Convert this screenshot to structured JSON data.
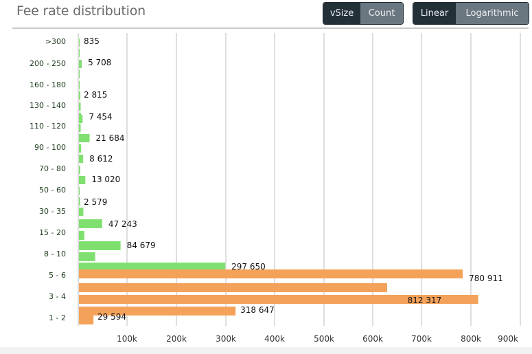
{
  "header": {
    "title": "Fee rate distribution",
    "metric_toggle": {
      "options": [
        "vSize",
        "Count"
      ],
      "selected": "vSize"
    },
    "scale_toggle": {
      "options": [
        "Linear",
        "Logarithmic"
      ],
      "selected": "Linear"
    }
  },
  "colors": {
    "low_fee_bar": "#7fe070",
    "high_volume_bar": "#f4a15a",
    "grid": "#d4d4d4",
    "button_active": "#233038",
    "button_inactive": "#6b7780"
  },
  "chart_data": {
    "type": "bar",
    "orientation": "horizontal",
    "title": "Fee rate distribution",
    "xlabel": "",
    "ylabel": "",
    "xlim": [
      0,
      900000
    ],
    "x_ticks": [
      "100k",
      "200k",
      "300k",
      "400k",
      "500k",
      "600k",
      "700k",
      "800k",
      "900k"
    ],
    "x_tick_values": [
      100000,
      200000,
      300000,
      400000,
      500000,
      600000,
      700000,
      800000,
      900000
    ],
    "grid": true,
    "legend": "none",
    "category_labels": [
      ">300",
      "200 - 250",
      "160 - 180",
      "130 - 140",
      "110 - 120",
      "90 - 100",
      "70 - 80",
      "50 - 60",
      "30 - 35",
      "15 - 20",
      "8 - 10",
      "5 - 6",
      "3 - 4",
      "1 - 2"
    ],
    "bars": [
      {
        "value": 835,
        "label": "835",
        "color": "green"
      },
      {
        "value": 1500,
        "label": "",
        "color": "green"
      },
      {
        "value": 5708,
        "label": "5 708",
        "color": "green"
      },
      {
        "value": 1000,
        "label": "",
        "color": "green"
      },
      {
        "value": 900,
        "label": "",
        "color": "green"
      },
      {
        "value": 2815,
        "label": "2 815",
        "color": "green"
      },
      {
        "value": 3500,
        "label": "",
        "color": "green"
      },
      {
        "value": 4500,
        "label": "",
        "color": "green"
      },
      {
        "value": 7454,
        "label": "7 454",
        "color": "green"
      },
      {
        "value": 3500,
        "label": "",
        "color": "green"
      },
      {
        "value": 21684,
        "label": "21 684",
        "color": "green"
      },
      {
        "value": 4500,
        "label": "",
        "color": "green"
      },
      {
        "value": 8612,
        "label": "8 612",
        "color": "green"
      },
      {
        "value": 2500,
        "label": "",
        "color": "green"
      },
      {
        "value": 13020,
        "label": "13 020",
        "color": "green"
      },
      {
        "value": 1000,
        "label": "",
        "color": "green"
      },
      {
        "value": 2579,
        "label": "2 579",
        "color": "green"
      },
      {
        "value": 9000,
        "label": "",
        "color": "green"
      },
      {
        "value": 47243,
        "label": "47 243",
        "color": "green"
      },
      {
        "value": 11000,
        "label": "",
        "color": "green"
      },
      {
        "value": 84679,
        "label": "84 679",
        "color": "green"
      },
      {
        "value": 33000,
        "label": "",
        "color": "green"
      },
      {
        "value": 297650,
        "label": "297 650",
        "color": "green"
      },
      {
        "value": 780911,
        "label": "780 911",
        "color": "orange"
      },
      {
        "value": 627000,
        "label": "",
        "color": "orange"
      },
      {
        "value": 812317,
        "label": "812 317",
        "color": "orange"
      },
      {
        "value": 318647,
        "label": "318 647",
        "color": "orange"
      },
      {
        "value": 29594,
        "label": "29 594",
        "color": "orange"
      }
    ]
  }
}
